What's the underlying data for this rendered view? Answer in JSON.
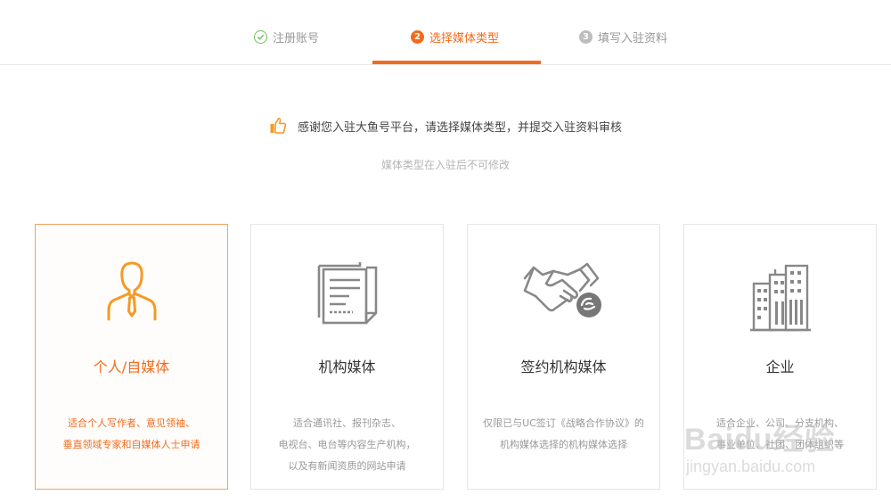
{
  "steps": [
    {
      "label": "注册账号",
      "state": "done"
    },
    {
      "label": "选择媒体类型",
      "number": "2",
      "state": "active"
    },
    {
      "label": "填写入驻资料",
      "number": "3",
      "state": "pending"
    }
  ],
  "notice": {
    "main": "感谢您入驻大鱼号平台，请选择媒体类型，并提交入驻资料审核",
    "sub": "媒体类型在入驻后不可修改"
  },
  "cards": [
    {
      "title": "个人/自媒体",
      "desc": [
        "适合个人写作者、意见领袖、",
        "垂直领域专家和自媒体人士申请"
      ],
      "selected": true
    },
    {
      "title": "机构媒体",
      "desc": [
        "适合通讯社、报刊杂志、",
        "电视台、电台等内容生产机构，",
        "以及有新闻资质的网站申请"
      ],
      "selected": false
    },
    {
      "title": "签约机构媒体",
      "desc": [
        "仅限已与UC签订《战略合作协议》的",
        "机构媒体选择的机构媒体选择"
      ],
      "selected": false
    },
    {
      "title": "企业",
      "desc": [
        "适合企业、公司、分支机构、",
        "事业单位、社团、团体组织等"
      ],
      "selected": false
    }
  ],
  "watermark": {
    "logo": "Baidu经验",
    "url": "jingyan.baidu.com"
  },
  "colors": {
    "accent": "#f26b1d",
    "done": "#6ac259",
    "muted": "#999999"
  }
}
